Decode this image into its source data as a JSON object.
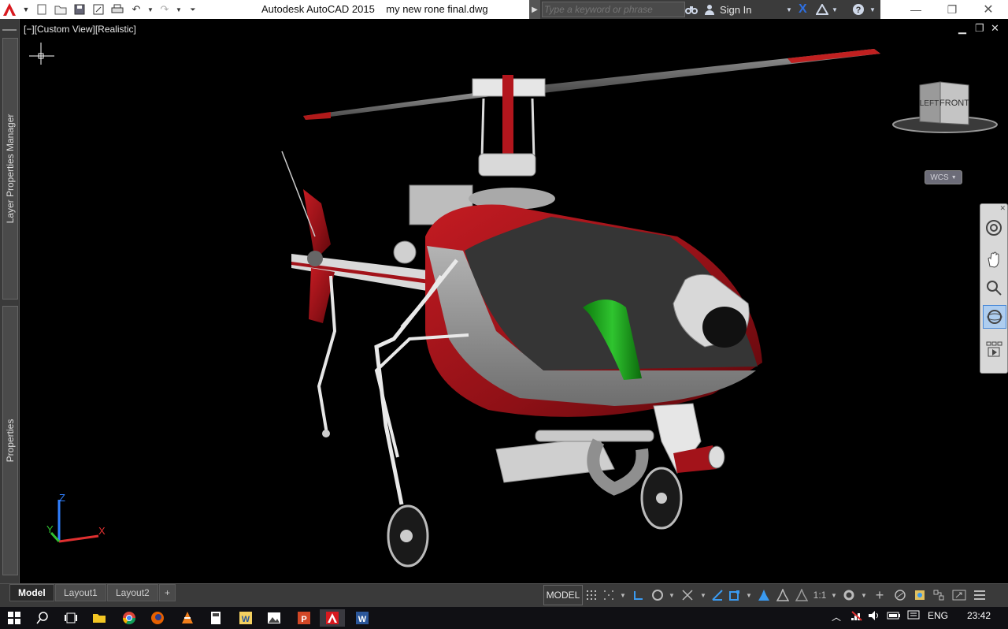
{
  "window": {
    "title": "Autodesk AutoCAD 2015    my new rone final.dwg"
  },
  "search": {
    "placeholder": "Type a keyword or phrase",
    "sign_in": "Sign In"
  },
  "palettes": {
    "layer_manager": "Layer Properties Manager",
    "properties": "Properties"
  },
  "viewport": {
    "controls": "[−][Custom View][Realistic]",
    "viewcube_left": "LEFT",
    "viewcube_front": "FRONT",
    "wcs": "WCS",
    "ucs_z": "Z",
    "ucs_y": "Y",
    "ucs_x": "X"
  },
  "layout_tabs": [
    {
      "label": "Model",
      "active": true
    },
    {
      "label": "Layout1",
      "active": false
    },
    {
      "label": "Layout2",
      "active": false
    },
    {
      "label": "+",
      "active": false
    }
  ],
  "status_bar": {
    "model": "MODEL",
    "scale": "1:1"
  },
  "taskbar": {
    "language": "ENG",
    "time": "23:42"
  },
  "colors": {
    "helicopter_body": "#a3131a",
    "canopy_grey": "#3a3a3a",
    "accent_green": "#14a014",
    "ucs_blue": "#3080ff",
    "ucs_red": "#e03030",
    "ucs_green": "#30c030"
  }
}
